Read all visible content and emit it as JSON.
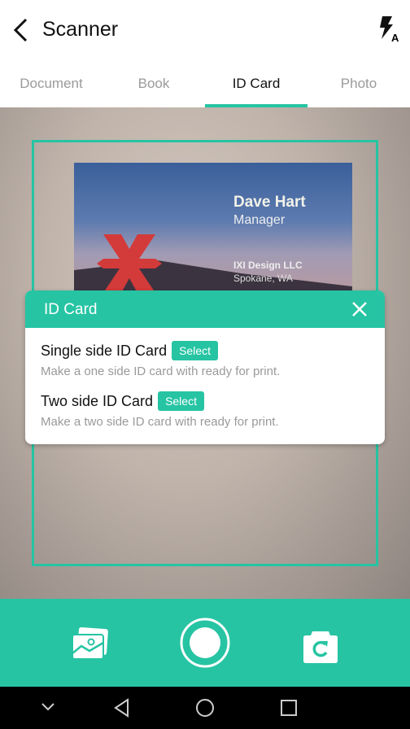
{
  "header": {
    "title": "Scanner",
    "back_icon": "chevron-left-icon",
    "flash_icon": "flash-auto-icon"
  },
  "tabs": [
    {
      "label": "Document"
    },
    {
      "label": "Book"
    },
    {
      "label": "ID Card",
      "active": true
    },
    {
      "label": "Photo"
    }
  ],
  "card": {
    "name": "Dave Hart",
    "role": "Manager",
    "company": "IXI Design LLC",
    "city": "Spokane, WA"
  },
  "dialog": {
    "title": "ID Card",
    "options": [
      {
        "title": "Single side ID Card",
        "button": "Select",
        "description": "Make a one side ID card with ready for print."
      },
      {
        "title": "Two side ID Card",
        "button": "Select",
        "description": "Make a two side ID card with ready for print."
      }
    ]
  },
  "colors": {
    "accent": "#26c4a3"
  }
}
